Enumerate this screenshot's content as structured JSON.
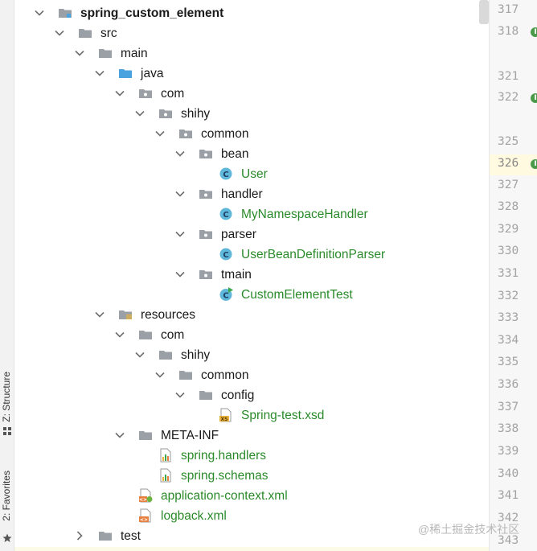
{
  "colors": {
    "folder_grey": "#9aa0a6",
    "folder_blue": "#4aa3df",
    "java_class": "#5fb7d9",
    "file_green_text": "#2a8a2a",
    "xml_orange": "#e77f3f",
    "marker_green": "#4a9a4a"
  },
  "side_panel": {
    "structure_label": "Z: Structure",
    "favorites_label": "2: Favorites"
  },
  "tree": {
    "nodes": [
      {
        "label": "spring_custom_element",
        "icon": "module-folder-icon",
        "expanded": true,
        "bold": true
      },
      {
        "label": "src",
        "icon": "folder-icon",
        "expanded": true
      },
      {
        "label": "main",
        "icon": "folder-icon",
        "expanded": true
      },
      {
        "label": "java",
        "icon": "source-root-folder-icon",
        "expanded": true
      },
      {
        "label": "com",
        "icon": "package-icon",
        "expanded": true
      },
      {
        "label": "shihy",
        "icon": "package-icon",
        "expanded": true
      },
      {
        "label": "common",
        "icon": "package-icon",
        "expanded": true
      },
      {
        "label": "bean",
        "icon": "package-icon",
        "expanded": true
      },
      {
        "label": "User",
        "icon": "java-class-icon"
      },
      {
        "label": "handler",
        "icon": "package-icon",
        "expanded": true
      },
      {
        "label": "MyNamespaceHandler",
        "icon": "java-class-icon"
      },
      {
        "label": "parser",
        "icon": "package-icon",
        "expanded": true
      },
      {
        "label": "UserBeanDefinitionParser",
        "icon": "java-class-icon"
      },
      {
        "label": "tmain",
        "icon": "package-icon",
        "expanded": true
      },
      {
        "label": "CustomElementTest",
        "icon": "java-runnable-class-icon"
      },
      {
        "label": "resources",
        "icon": "resources-folder-icon",
        "expanded": true
      },
      {
        "label": "com",
        "icon": "folder-icon",
        "expanded": true
      },
      {
        "label": "shihy",
        "icon": "folder-icon",
        "expanded": true
      },
      {
        "label": "common",
        "icon": "folder-icon",
        "expanded": true
      },
      {
        "label": "config",
        "icon": "folder-icon",
        "expanded": true
      },
      {
        "label": "Spring-test.xsd",
        "icon": "xsd-file-icon"
      },
      {
        "label": "META-INF",
        "icon": "folder-icon",
        "expanded": true
      },
      {
        "label": "spring.handlers",
        "icon": "properties-file-icon"
      },
      {
        "label": "spring.schemas",
        "icon": "properties-file-icon"
      },
      {
        "label": "application-context.xml",
        "icon": "spring-xml-file-icon"
      },
      {
        "label": "logback.xml",
        "icon": "xml-file-icon"
      },
      {
        "label": "test",
        "icon": "folder-icon",
        "expanded": false
      }
    ]
  },
  "gutter": {
    "line_numbers": [
      "317",
      "318",
      "321",
      "322",
      "325",
      "326",
      "327",
      "328",
      "329",
      "330",
      "331",
      "332",
      "333",
      "334",
      "335",
      "336",
      "337",
      "338",
      "339",
      "340",
      "341",
      "342",
      "343"
    ],
    "current_line": "326",
    "marker_glyph": "I"
  },
  "watermark": "@稀土掘金技术社区"
}
